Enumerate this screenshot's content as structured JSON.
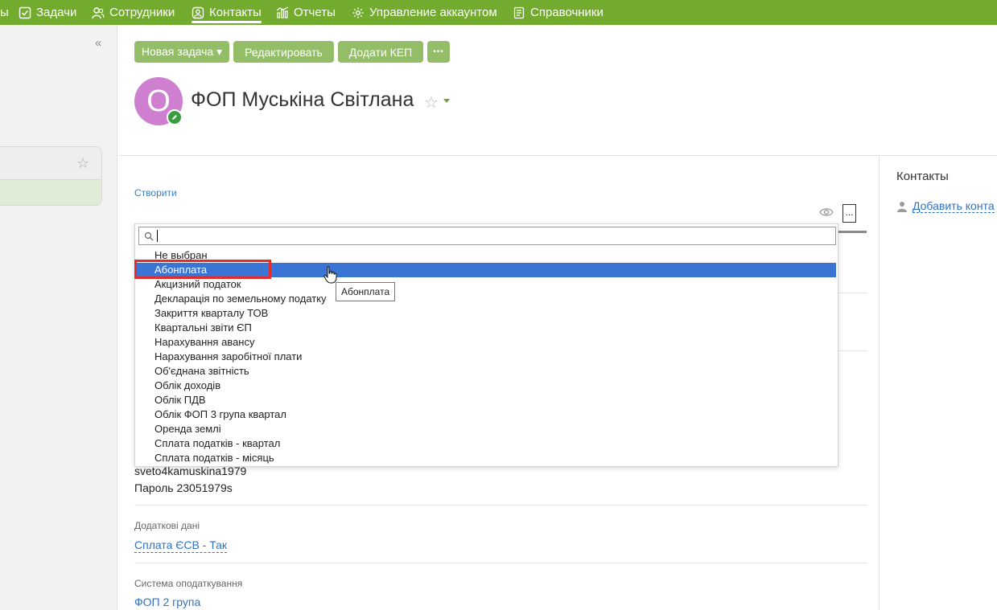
{
  "nav": {
    "items": [
      {
        "label": "ы"
      },
      {
        "label": "Задачи"
      },
      {
        "label": "Сотрудники"
      },
      {
        "label": "Контакты"
      },
      {
        "label": "Отчеты"
      },
      {
        "label": "Управление аккаунтом"
      },
      {
        "label": "Справочники"
      }
    ],
    "active_index": 3
  },
  "sidebar": {
    "collapse_glyph": "«"
  },
  "toolbar": {
    "new_task": "Новая задача ▾",
    "edit": "Редактировать",
    "add_kep": "Додати КЕП",
    "more": "•••"
  },
  "contact": {
    "avatar_letter": "О",
    "title": "ФОП Муськіна Світлана"
  },
  "main": {
    "create_link": "Створити",
    "more_box": "...",
    "login_text": "sveto4kamuskina1979",
    "password_text": "Пароль 23051979s",
    "extra_label": "Додаткові дані",
    "extra_value": "Сплата ЄСВ - Так",
    "tax_label": "Система оподаткування",
    "tax_value": "ФОП 2 група"
  },
  "dropdown": {
    "options": [
      "Не выбран",
      "Абонплата",
      "Акцизний податок",
      "Декларація по земельному податку",
      "Закриття кварталу ТОВ",
      "Квартальні звіти ЄП",
      "Нарахування авансу",
      "Нарахування заробітної плати",
      "Об'єднана звітність",
      "Облік доходів",
      "Облік ПДВ",
      "Облік ФОП 3 група квартал",
      "Оренда землі",
      "Сплата податків - квартал",
      "Сплата податків - місяць"
    ],
    "selected_index": 1,
    "tooltip": "Абонплата"
  },
  "right_panel": {
    "heading": "Контакты",
    "add_contact": "Добавить конта"
  },
  "colors": {
    "nav_bg": "#72ab2e",
    "button_bg": "#93bd66",
    "selected_bg": "#3a75d6",
    "highlight_border": "#e52a2a",
    "avatar_bg": "#cf7fd0",
    "link": "#2f73c0"
  }
}
